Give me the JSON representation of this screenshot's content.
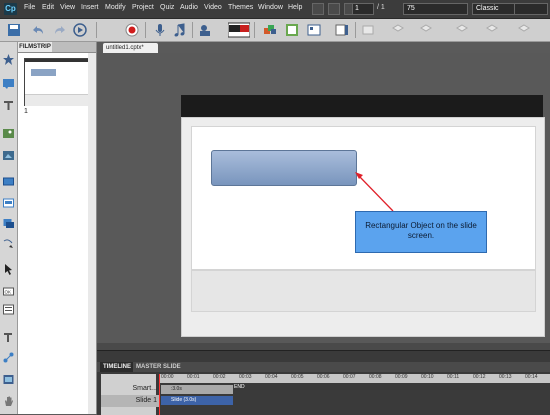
{
  "app": {
    "logo_text": "Cp",
    "menus": [
      "File",
      "Edit",
      "View",
      "Insert",
      "Modify",
      "Project",
      "Quiz",
      "Audio",
      "Video",
      "Themes",
      "Window",
      "Help"
    ],
    "page_current": "1",
    "page_total": "/ 1",
    "zoom": "75",
    "workspace": "Classic"
  },
  "toolbar": {
    "icons": [
      "save-icon",
      "undo-icon",
      "redo-icon",
      "preview-icon",
      "record-icon",
      "microphone-icon",
      "audio-icon",
      "video-icon",
      "youtube-icon",
      "slide-effect-icon",
      "widget-icon",
      "properties-icon"
    ]
  },
  "filmstrip": {
    "tab_label": "FILMSTRIP",
    "slide_number": "1"
  },
  "document": {
    "tab_label": "untitled1.cptx*"
  },
  "slide": {
    "callout_text": "Rectangular Object on the slide screen.",
    "accent_color": "#e0202a",
    "callout_color": "#5ba3ee",
    "object_color": "#8aa3c4"
  },
  "timeline": {
    "tab_timeline": "TIMELINE",
    "tab_master": "MASTER SLIDE",
    "ruler_ticks": [
      "00:00",
      "00:01",
      "00:02",
      "00:03",
      "00:04",
      "00:05",
      "00:06",
      "00:07",
      "00:08",
      "00:09",
      "00:10",
      "00:11",
      "00:12",
      "00:13",
      "00:14",
      "00:15"
    ],
    "rows": [
      {
        "name": "Smart...",
        "bar_label": ":3.0s"
      },
      {
        "name": "Slide 1",
        "bar_label": "Slide (3.0s)"
      }
    ],
    "end_label": "END"
  }
}
